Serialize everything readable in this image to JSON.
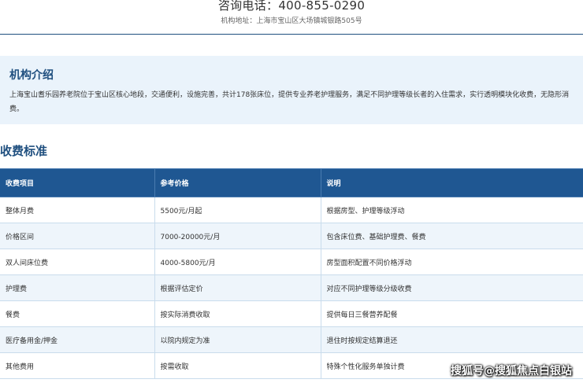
{
  "contact": {
    "phone": "咨询电话：400-855-0290",
    "address": "机构地址：上海市宝山区大场镇城银路505号"
  },
  "intro": {
    "title": "机构介绍",
    "text": "上海宝山耆乐园养老院位于宝山区核心地段，交通便利，设施完善，共计178张床位，提供专业养老护理服务，满足不同护理等级长者的入住需求，实行透明模块化收费，无隐形消费。"
  },
  "fees": {
    "title": "收费标准",
    "headers": [
      "收费项目",
      "参考价格",
      "说明"
    ],
    "rows": [
      [
        "整体月费",
        "5500元/月起",
        "根据房型、护理等级浮动"
      ],
      [
        "价格区间",
        "7000-20000元/月",
        "包含床位费、基础护理费、餐费"
      ],
      [
        "双人间床位费",
        "4000-5800元/月",
        "房型面积配置不同价格浮动"
      ],
      [
        "护理费",
        "根据评估定价",
        "对应不同护理等级分级收费"
      ],
      [
        "餐费",
        "按实际消费收取",
        "提供每日三餐营养配餐"
      ],
      [
        "医疗备用金/押金",
        "以院内规定为准",
        "退住时按规定结算退还"
      ],
      [
        "其他费用",
        "按需收取",
        "特殊个性化服务单独计费"
      ]
    ]
  },
  "watermark": "搜狐号@搜狐焦点白银站"
}
